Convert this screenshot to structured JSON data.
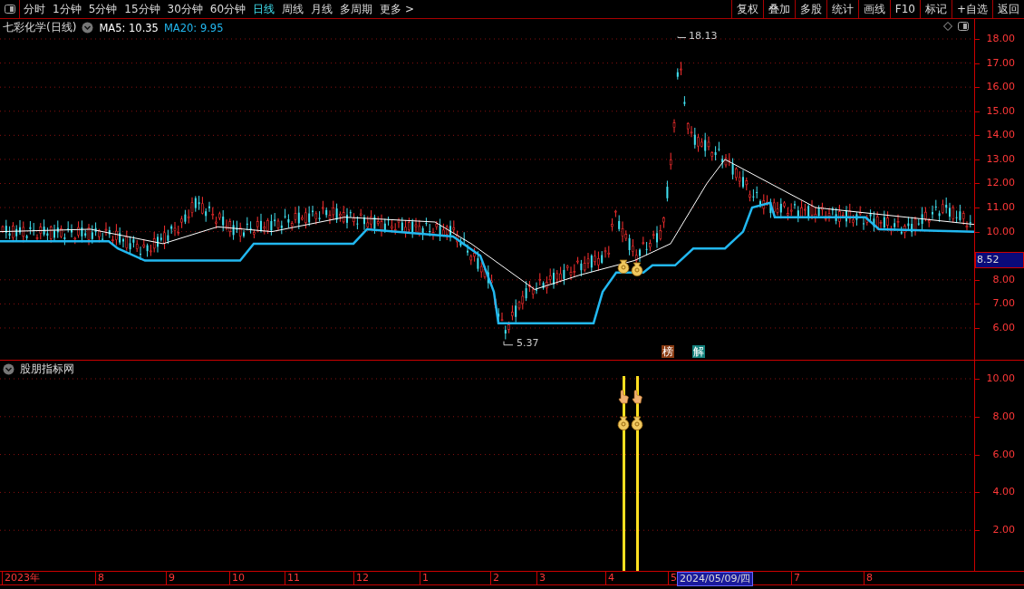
{
  "toolbar": {
    "periods": [
      {
        "label": "分时",
        "selected": false
      },
      {
        "label": "1分钟",
        "selected": false
      },
      {
        "label": "5分钟",
        "selected": false
      },
      {
        "label": "15分钟",
        "selected": false
      },
      {
        "label": "30分钟",
        "selected": false
      },
      {
        "label": "60分钟",
        "selected": false
      },
      {
        "label": "日线",
        "selected": true
      },
      {
        "label": "周线",
        "selected": false
      },
      {
        "label": "月线",
        "selected": false
      },
      {
        "label": "多周期",
        "selected": false
      },
      {
        "label": "更多 >",
        "selected": false
      }
    ],
    "actions": [
      "复权",
      "叠加",
      "多股",
      "统计",
      "画线",
      "F10",
      "标记",
      "+自选",
      "返回"
    ]
  },
  "chart": {
    "title": "七彩化学(日线)",
    "legend": [
      {
        "label": "MA5: 10.35",
        "color": "#ffffff"
      },
      {
        "label": "MA20: 9.95",
        "color": "#22b8f0"
      }
    ],
    "high_label": "18.13",
    "low_label": "5.37",
    "price_axis": [
      "18.00",
      "17.00",
      "16.00",
      "15.00",
      "14.00",
      "13.00",
      "12.00",
      "11.00",
      "10.00",
      "8.00",
      "7.00",
      "6.00"
    ],
    "current_price": "8.52",
    "badges": [
      {
        "text": "榜",
        "kind": "list"
      },
      {
        "text": "解",
        "kind": "explain"
      }
    ]
  },
  "indicator": {
    "title": "股朋指标网",
    "axis": [
      "10.00",
      "8.00",
      "6.00",
      "4.00",
      "2.00"
    ]
  },
  "time_axis": {
    "labels": [
      "2023年",
      "8",
      "9",
      "10",
      "11",
      "12",
      "1",
      "2",
      "3",
      "4",
      "5",
      "7",
      "8"
    ],
    "cursor_date": "2024/05/09/四"
  }
}
